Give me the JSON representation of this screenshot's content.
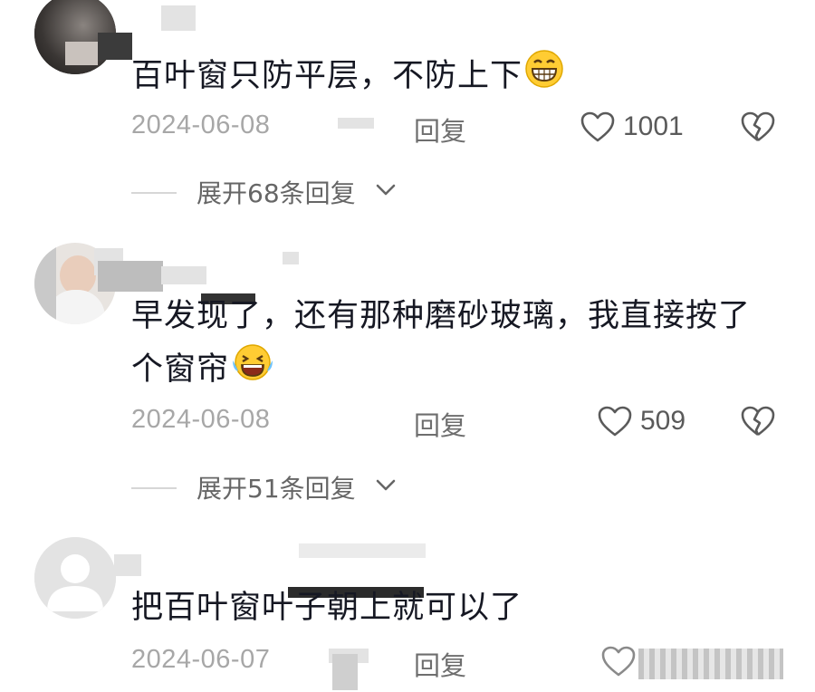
{
  "comments": [
    {
      "text": "百叶窗只防平层，不防上下",
      "emoji": "grinning-face",
      "date": "2024-06-08",
      "reply": "回复",
      "likes": "1001",
      "expand": "展开68条回复"
    },
    {
      "text_line1": "早发现了，还有那种磨砂玻璃，我直接按了",
      "text_line2": "个窗帘",
      "emoji": "laughing-tears-face",
      "date": "2024-06-08",
      "reply": "回复",
      "likes": "509",
      "expand": "展开51条回复"
    },
    {
      "text": "把百叶窗叶子朝上就可以了",
      "date": "2024-06-07",
      "reply": "回复"
    }
  ],
  "icons": [
    "heart-icon",
    "broken-heart-icon",
    "chevron-down-icon",
    "default-avatar-icon"
  ],
  "colors": {
    "text": "#161823",
    "meta": "#a7a7a7",
    "reply": "#6e6e6e"
  }
}
